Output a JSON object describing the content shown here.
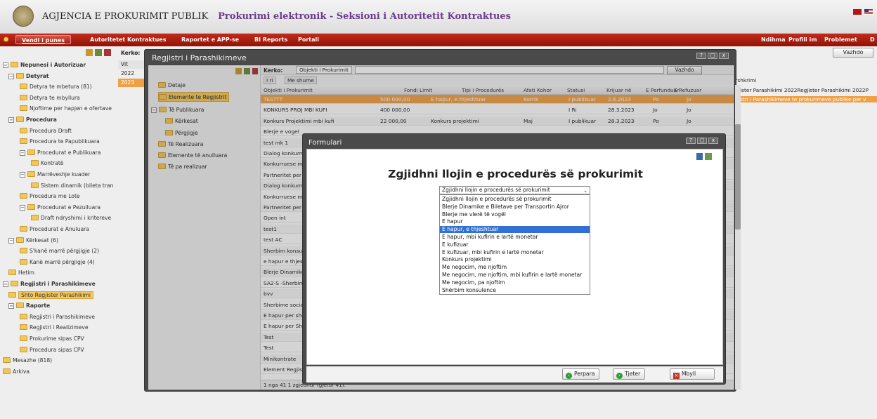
{
  "header": {
    "agency": "AGJENCIA E PROKURIMIT PUBLIK",
    "subtitle": "Prokurimi elektronik - Seksioni i Autoritetit Kontraktues"
  },
  "menu": {
    "items": [
      "Vendi i punes",
      "Autoritetet Kontraktues",
      "Raportet e APP-se",
      "BI Reports",
      "Portali"
    ],
    "right": [
      "Ndihma",
      "Profili im",
      "Problemet",
      "D"
    ]
  },
  "background": {
    "kerko": "Kerko:",
    "vazhdo": "Vazhdo",
    "year_rows": [
      "Vit",
      "2022",
      "2023"
    ],
    "right_col_header": "ërshkrimi",
    "right_rows": [
      "egjister Parashikimi 2022Regjister Parashikimi 2022P",
      "egjstri i Parashikimeve te prokurimeve publike per v"
    ]
  },
  "tree": [
    {
      "label": "Nepunesi i Autorizuar",
      "bold": true
    },
    {
      "label": "Detyrat",
      "bold": true
    },
    {
      "label": "Detyra te mbetura (81)"
    },
    {
      "label": "Detyra te mbyllura"
    },
    {
      "label": "Njoftime per hapjen e ofertave"
    },
    {
      "label": "Procedura",
      "bold": true
    },
    {
      "label": "Procedura Draft"
    },
    {
      "label": "Procedura te Papublikuara"
    },
    {
      "label": "Procedurat e Publikuara"
    },
    {
      "label": "Kontratë"
    },
    {
      "label": "Marrëveshje kuader"
    },
    {
      "label": "Sistem dinamik (bileta tran"
    },
    {
      "label": "Procedura me Lote"
    },
    {
      "label": "Procedurat e Pezulluara"
    },
    {
      "label": "Draft ndryshimi i kritereve"
    },
    {
      "label": "Procedurat e Anuluara"
    },
    {
      "label": "Kërkesat (6)"
    },
    {
      "label": "S'kanë marrë përgjigje (2)"
    },
    {
      "label": "Kanë marrë përgjigje (4)"
    },
    {
      "label": "Hetim"
    },
    {
      "label": "Regjistri i Parashikimeve",
      "bold": true
    },
    {
      "label": "Shto Regjister Parashikimi"
    },
    {
      "label": "Raporte",
      "bold": true
    },
    {
      "label": "Regjistri i Parashikimeve"
    },
    {
      "label": "Regjistri i Realizimeve"
    },
    {
      "label": "Prokurime sipas CPV"
    },
    {
      "label": "Procedura sipas CPV"
    },
    {
      "label": "Mesazhe (818)"
    },
    {
      "label": "Arkiva"
    }
  ],
  "window": {
    "title": "Regjistri i Parashikimeve",
    "left_items": [
      "Detaje",
      "Elemente te Regjistrit",
      "Të Publikuara",
      "Kërkesat",
      "Përgjigje",
      "Të Realizuara",
      "Elemente të anulluara",
      "Të pa realizuar"
    ],
    "search_label": "Kerko:",
    "search_field": "Objekti i Prokurimit",
    "search_button": "Vazhdo",
    "toolbar": [
      "I ri",
      "Me shume"
    ],
    "columns": [
      "Objekti i Prokurimit",
      "Fondi Limit",
      "Tipi i Procedurës",
      "Afati Kohor",
      "Statusi",
      "Krijuar në",
      "E Perfunduar",
      "E Refuzuar"
    ],
    "rows": [
      [
        "TESTTT",
        "500 000,00",
        "E hapur, e thjeshtuar",
        "Korrik",
        "I publikuar",
        "2.6.2023",
        "Po",
        "Jo"
      ],
      [
        "KONKURS PROJ MBI KUFI",
        "400 000,00",
        "",
        "",
        "I Ri",
        "28.3.2023",
        "Jo",
        "Jo"
      ],
      [
        "Konkurs Projektimi mbi kufi",
        "22 000,00",
        "Konkurs projektimi",
        "Maj",
        "I publikuar",
        "28.3.2023",
        "Po",
        "Jo"
      ],
      [
        "Blerje e vogel"
      ],
      [
        "test mk 1"
      ],
      [
        "Dialog konkurru"
      ],
      [
        "Konkurruese me"
      ],
      [
        "Partneritet per i"
      ],
      [
        "Dialog konkurru"
      ],
      [
        "Konkurruese me"
      ],
      [
        "Partneritet per i"
      ],
      [
        "Open int"
      ],
      [
        "test1"
      ],
      [
        "test AC"
      ],
      [
        "Sherbim konsule"
      ],
      [
        "e hapur e thjesh"
      ],
      [
        "Blerje Dinamike"
      ],
      [
        "SA2-S -Sherbim"
      ],
      [
        "bvv"
      ],
      [
        "Sherbime sociale"
      ],
      [
        "E hapur per sher"
      ],
      [
        "E hapur per Shë"
      ],
      [
        "Test"
      ],
      [
        "Test"
      ],
      [
        "Minikontrate"
      ],
      [
        "Element Regjistr"
      ]
    ],
    "pager": "1 nga 41 1 zgjedhur (gjetur 41)."
  },
  "dialog": {
    "title": "Formulari",
    "heading": "Zgjidhni llojin e procedurës së prokurimit",
    "select_value": "Zgjidhni llojin e procedurës së prokurimit",
    "options": [
      "Zgjidhni llojin e procedurës së prokurimit",
      "Blerje Dinamike e Biletave per Transportin Ajror",
      "Blerje me vlerë të vogël",
      "E hapur",
      "E hapur, e thjeshtuar",
      "E hapur, mbi kufirin e lartë monetar",
      "E kufizuar",
      "E kufizuar, mbi kufirin e lartë monetar",
      "Konkurs projektimi",
      "Me negocim, me njoftim",
      "Me negocim, me njoftim, mbi kufirin e lartë monetar",
      "Me negocim, pa njoftim",
      "Shërbim konsulence"
    ],
    "selected_index": 4,
    "buttons": {
      "prev": "Perpara",
      "next": "Tjeter",
      "close": "Mbyll"
    }
  }
}
